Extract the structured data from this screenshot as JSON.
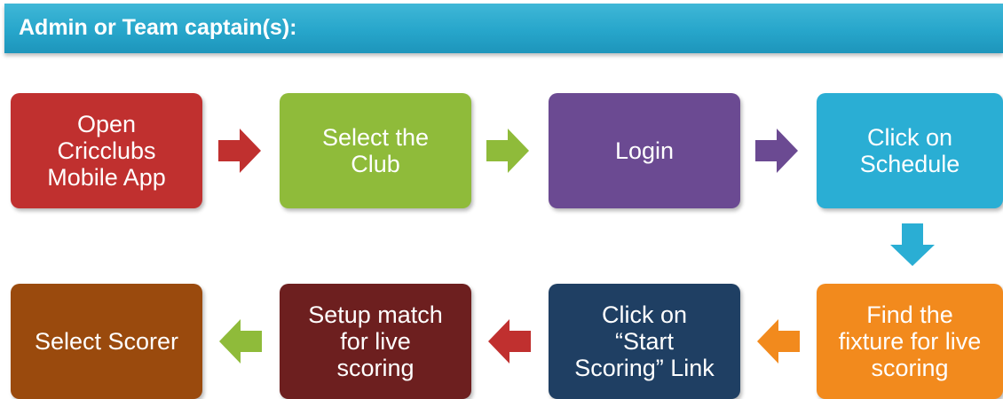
{
  "header": {
    "title": "Admin or Team captain(s):"
  },
  "steps": [
    {
      "label": "Open\nCricclubs\nMobile App",
      "color": "#c0302f"
    },
    {
      "label": "Select the\nClub",
      "color": "#8fbb3a"
    },
    {
      "label": "Login",
      "color": "#6b4a92"
    },
    {
      "label": "Click on\nSchedule",
      "color": "#2aaed4"
    },
    {
      "label": "Find the\nfixture for live\nscoring",
      "color": "#f28a1d"
    },
    {
      "label": "Click on\n“Start\nScoring” Link",
      "color": "#1f3f63"
    },
    {
      "label": "Setup match\nfor live\nscoring",
      "color": "#6d1f1f"
    },
    {
      "label": "Select Scorer",
      "color": "#9a4a0d"
    }
  ],
  "arrows": [
    {
      "direction": "right",
      "color": "#c0302f"
    },
    {
      "direction": "right",
      "color": "#8fbb3a"
    },
    {
      "direction": "right",
      "color": "#6b4a92"
    },
    {
      "direction": "down",
      "color": "#2aaed4"
    },
    {
      "direction": "left",
      "color": "#f28a1d"
    },
    {
      "direction": "left",
      "color": "#c0302f"
    },
    {
      "direction": "left",
      "color": "#8fbb3a"
    }
  ]
}
